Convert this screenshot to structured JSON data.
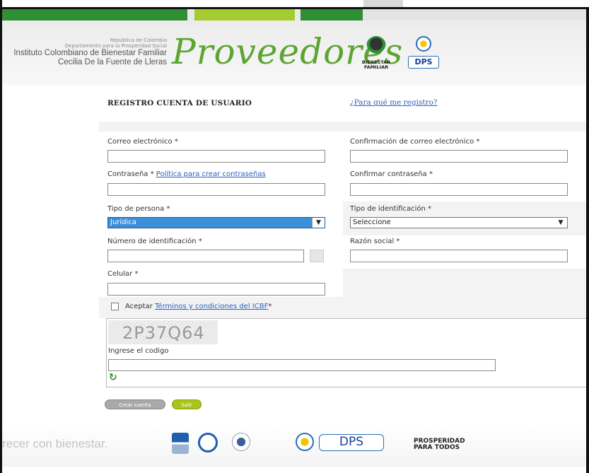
{
  "header": {
    "republica": "República de Colombia",
    "departamento": "Departamento para la Prosperidad Social",
    "institute_line1": "Instituto Colombiano de Bienestar Familiar",
    "institute_line2": "Cecilia De la Fuente de Lleras",
    "title": "Proveedores",
    "bienestar_logo_text": "BIENESTAR FAMILIAR",
    "dps_logo_text": "DPS"
  },
  "form": {
    "title": "REGISTRO CUENTA DE USUARIO",
    "why_link": "¿Para qué me registro?",
    "email_label": "Correo electrónico *",
    "email_confirm_label": "Confirmación de correo electrónico *",
    "password_label": "Contraseña *",
    "password_policy_link": "Política para crear contraseñas",
    "password_confirm_label": "Confirmar contraseña *",
    "person_type_label": "Tipo de persona *",
    "person_type_value": "Jurídica",
    "id_type_label": "Tipo de identificación *",
    "id_type_value": "Seleccione",
    "id_number_label": "Número de identificación *",
    "business_name_label": "Razón social *",
    "mobile_label": "Celular *",
    "accept_label": "Aceptar",
    "terms_link": "Términos y condiciones del ICBF",
    "terms_suffix": "*",
    "captcha_code": "2P37Q64",
    "captcha_label": "Ingrese el codigo",
    "create_button": "Crear cuenta",
    "exit_button": "Salir"
  },
  "footer": {
    "slogan": "recer con bienestar.",
    "dps": "DPS",
    "prosperidad_line1": "PROSPERIDAD",
    "prosperidad_line2": "PARA TODOS"
  },
  "colors": {
    "brand_green": "#5da533",
    "stripe_dark": "#2f8f35",
    "stripe_light": "#a5cc2e",
    "link_blue": "#2c5fbf",
    "select_active": "#3a8fd8"
  },
  "icons": [
    "bienestar-logo",
    "dps-logo",
    "caret-down-icon",
    "checkbox-icon",
    "refresh-icon"
  ]
}
